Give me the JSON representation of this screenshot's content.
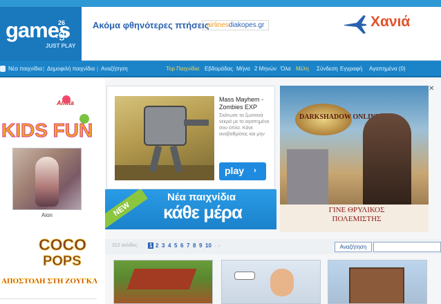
{
  "brand": {
    "name": "games",
    "suffix": ".gr",
    "superscript": "26",
    "tagline": "JUST PLAY"
  },
  "top_ad": {
    "text": "Ακόμα φθηνότερες πτήσεις",
    "logo_prefix": "airlines",
    "logo_main": "diakopes.gr",
    "city": "Χανιά"
  },
  "nav": {
    "left_items": [
      "Νέα παιχνίδια",
      "Δημοφιλή παιχνίδια",
      "Αναζήτηση"
    ],
    "right_items": [
      "Top Παιχνίδια",
      "Εβδομάδας",
      "Μήνα",
      "2 Μηνών",
      "Όλα"
    ],
    "highlighted": "Μέλη",
    "user_items": [
      "Σύνδεση",
      "Εγγραφή",
      "Αγαπημένα (0)"
    ]
  },
  "sidebar": {
    "kids_logo_text": "KIDS FUN",
    "kids_brand": "Amita",
    "avatar_label": "Aion",
    "coco_logo_line1": "COCO",
    "coco_logo_line2": "POPS",
    "coco_sub": "ΑΠΟΣΤΟΛΗ ΣΤΗ ΖΟΥΓΚΛΑ"
  },
  "featured": {
    "title": "Mass Mayhem - Zombies EXP",
    "description": "Σκότωσε τα ζωντανά νεκρά με το αγαπημένο σου όπλο. Κάνε αναβαθμίσεις και μην",
    "play_label": "play",
    "play_arrow": "›"
  },
  "promo": {
    "badge": "NEW",
    "line1": "Νέα παιχνίδια",
    "line2": "κάθε μέρα"
  },
  "right_ad": {
    "game_name": "DARKSHADOW ONLINE",
    "bottom_text_1": "ΓΙΝΕ ΘΡΥΛΙΚΟΣ",
    "bottom_text_2": "ΠΟΛΕΜΙΣΤΗΣ",
    "ad_close": "✕"
  },
  "pager": {
    "label": "312 σελίδες:",
    "current": "1",
    "pages": [
      "2",
      "3",
      "4",
      "5",
      "6",
      "7",
      "8",
      "9",
      "10"
    ],
    "arrows": "› »",
    "search_button": "Αναζήτηση",
    "search_placeholder": ""
  },
  "thumbnails": [
    {
      "name": "strategy-castle-game"
    },
    {
      "name": "cartoon-office-game"
    },
    {
      "name": "house-builder-game"
    }
  ],
  "colors": {
    "brand_blue": "#1a78bd",
    "nav_blue": "#1b84c8",
    "accent_orange": "#e2522a",
    "link_blue": "#2a62b0"
  }
}
